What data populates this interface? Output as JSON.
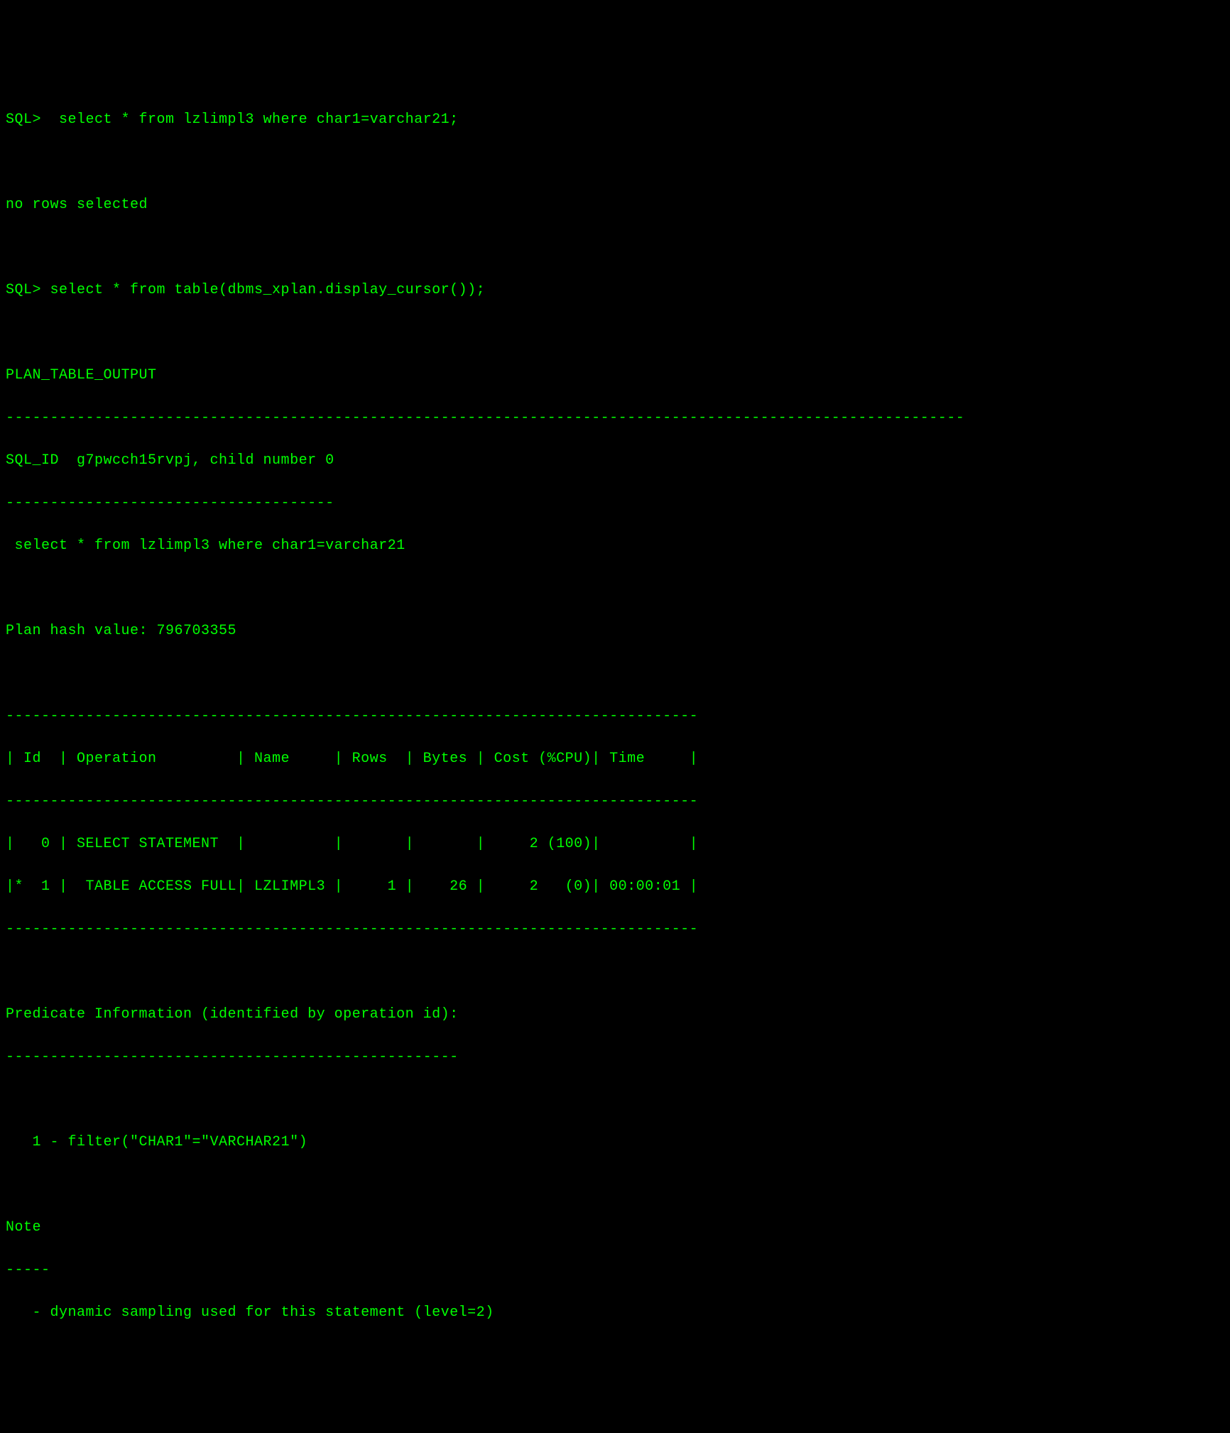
{
  "lines": {
    "l1": "SQL>  select * from lzlimpl3 where char1=varchar21;",
    "l2": "",
    "l3": "no rows selected",
    "l4": "",
    "l5": "SQL> select * from table(dbms_xplan.display_cursor());",
    "l6": "",
    "l7": "PLAN_TABLE_OUTPUT",
    "l8": "------------------------------------------------------------------------------------------------------------",
    "l9": "SQL_ID  g7pwcch15rvpj, child number 0",
    "l10": "-------------------------------------",
    "l11": " select * from lzlimpl3 where char1=varchar21",
    "l12": "",
    "l13": "Plan hash value: 796703355",
    "l14": "",
    "l15": "------------------------------------------------------------------------------",
    "l16": "| Id  | Operation         | Name     | Rows  | Bytes | Cost (%CPU)| Time     |",
    "l17": "------------------------------------------------------------------------------",
    "l18": "|   0 | SELECT STATEMENT  |          |       |       |     2 (100)|          |",
    "l19": "|*  1 |  TABLE ACCESS FULL| LZLIMPL3 |     1 |    26 |     2   (0)| 00:00:01 |",
    "l20": "------------------------------------------------------------------------------",
    "l21": "",
    "l22": "Predicate Information (identified by operation id):",
    "l23": "---------------------------------------------------",
    "l24": "",
    "l25": "   1 - filter(\"CHAR1\"=\"VARCHAR21\")",
    "l26": "",
    "l27": "Note",
    "l28": "-----",
    "l29": "   - dynamic sampling used for this statement (level=2)"
  },
  "chart_data": {
    "type": "table",
    "title": "Execution Plan",
    "sql_id": "g7pwcch15rvpj",
    "child_number": 0,
    "plan_hash_value": 796703355,
    "columns": [
      "Id",
      "Operation",
      "Name",
      "Rows",
      "Bytes",
      "Cost (%CPU)",
      "Time"
    ],
    "rows": [
      {
        "Id": "0",
        "Operation": "SELECT STATEMENT",
        "Name": "",
        "Rows": "",
        "Bytes": "",
        "Cost (%CPU)": "2 (100)",
        "Time": ""
      },
      {
        "Id": "* 1",
        "Operation": "TABLE ACCESS FULL",
        "Name": "LZLIMPL3",
        "Rows": "1",
        "Bytes": "26",
        "Cost (%CPU)": "2   (0)",
        "Time": "00:00:01"
      }
    ],
    "predicate_information": "1 - filter(\"CHAR1\"=\"VARCHAR21\")",
    "note": "dynamic sampling used for this statement (level=2)"
  }
}
